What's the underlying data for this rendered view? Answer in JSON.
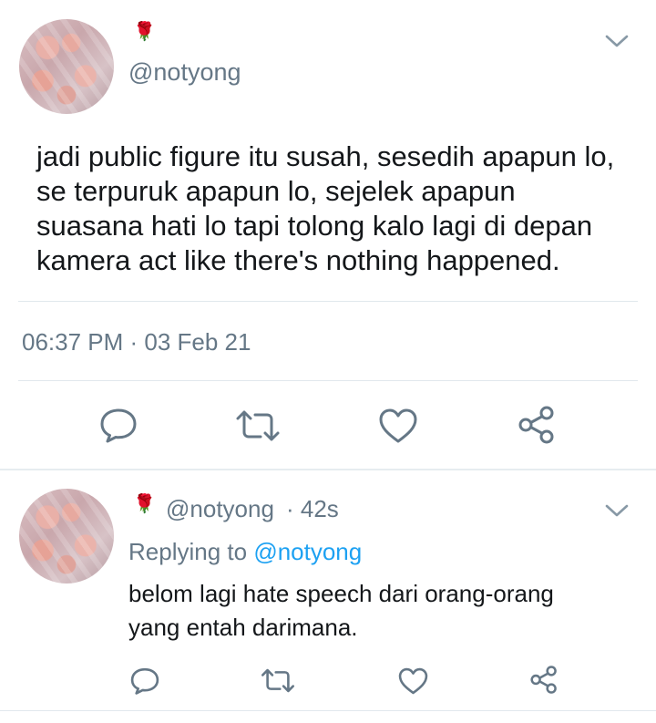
{
  "tweet": {
    "author_emoji": "🌹",
    "handle": "@notyong",
    "text": "jadi public figure itu susah, sesedih apapun lo, se terpuruk apapun lo, sejelek apapun suasana hati lo tapi tolong kalo lagi di depan kamera act like there's nothing happened.",
    "timestamp": "06:37 PM · 03 Feb 21"
  },
  "actions": [
    "reply-icon",
    "retweet-icon",
    "like-icon",
    "share-icon"
  ],
  "reply": {
    "author_emoji": "🌹",
    "handle": "@notyong",
    "age": "· 42s",
    "replying_prefix": "Replying to",
    "replying_handle": "@notyong",
    "text": "belom lagi hate speech dari orang-orang yang entah darimana."
  },
  "colors": {
    "accent": "#1da1f2",
    "muted": "#657786",
    "divider": "#e1e8ed",
    "text": "#14171a"
  }
}
